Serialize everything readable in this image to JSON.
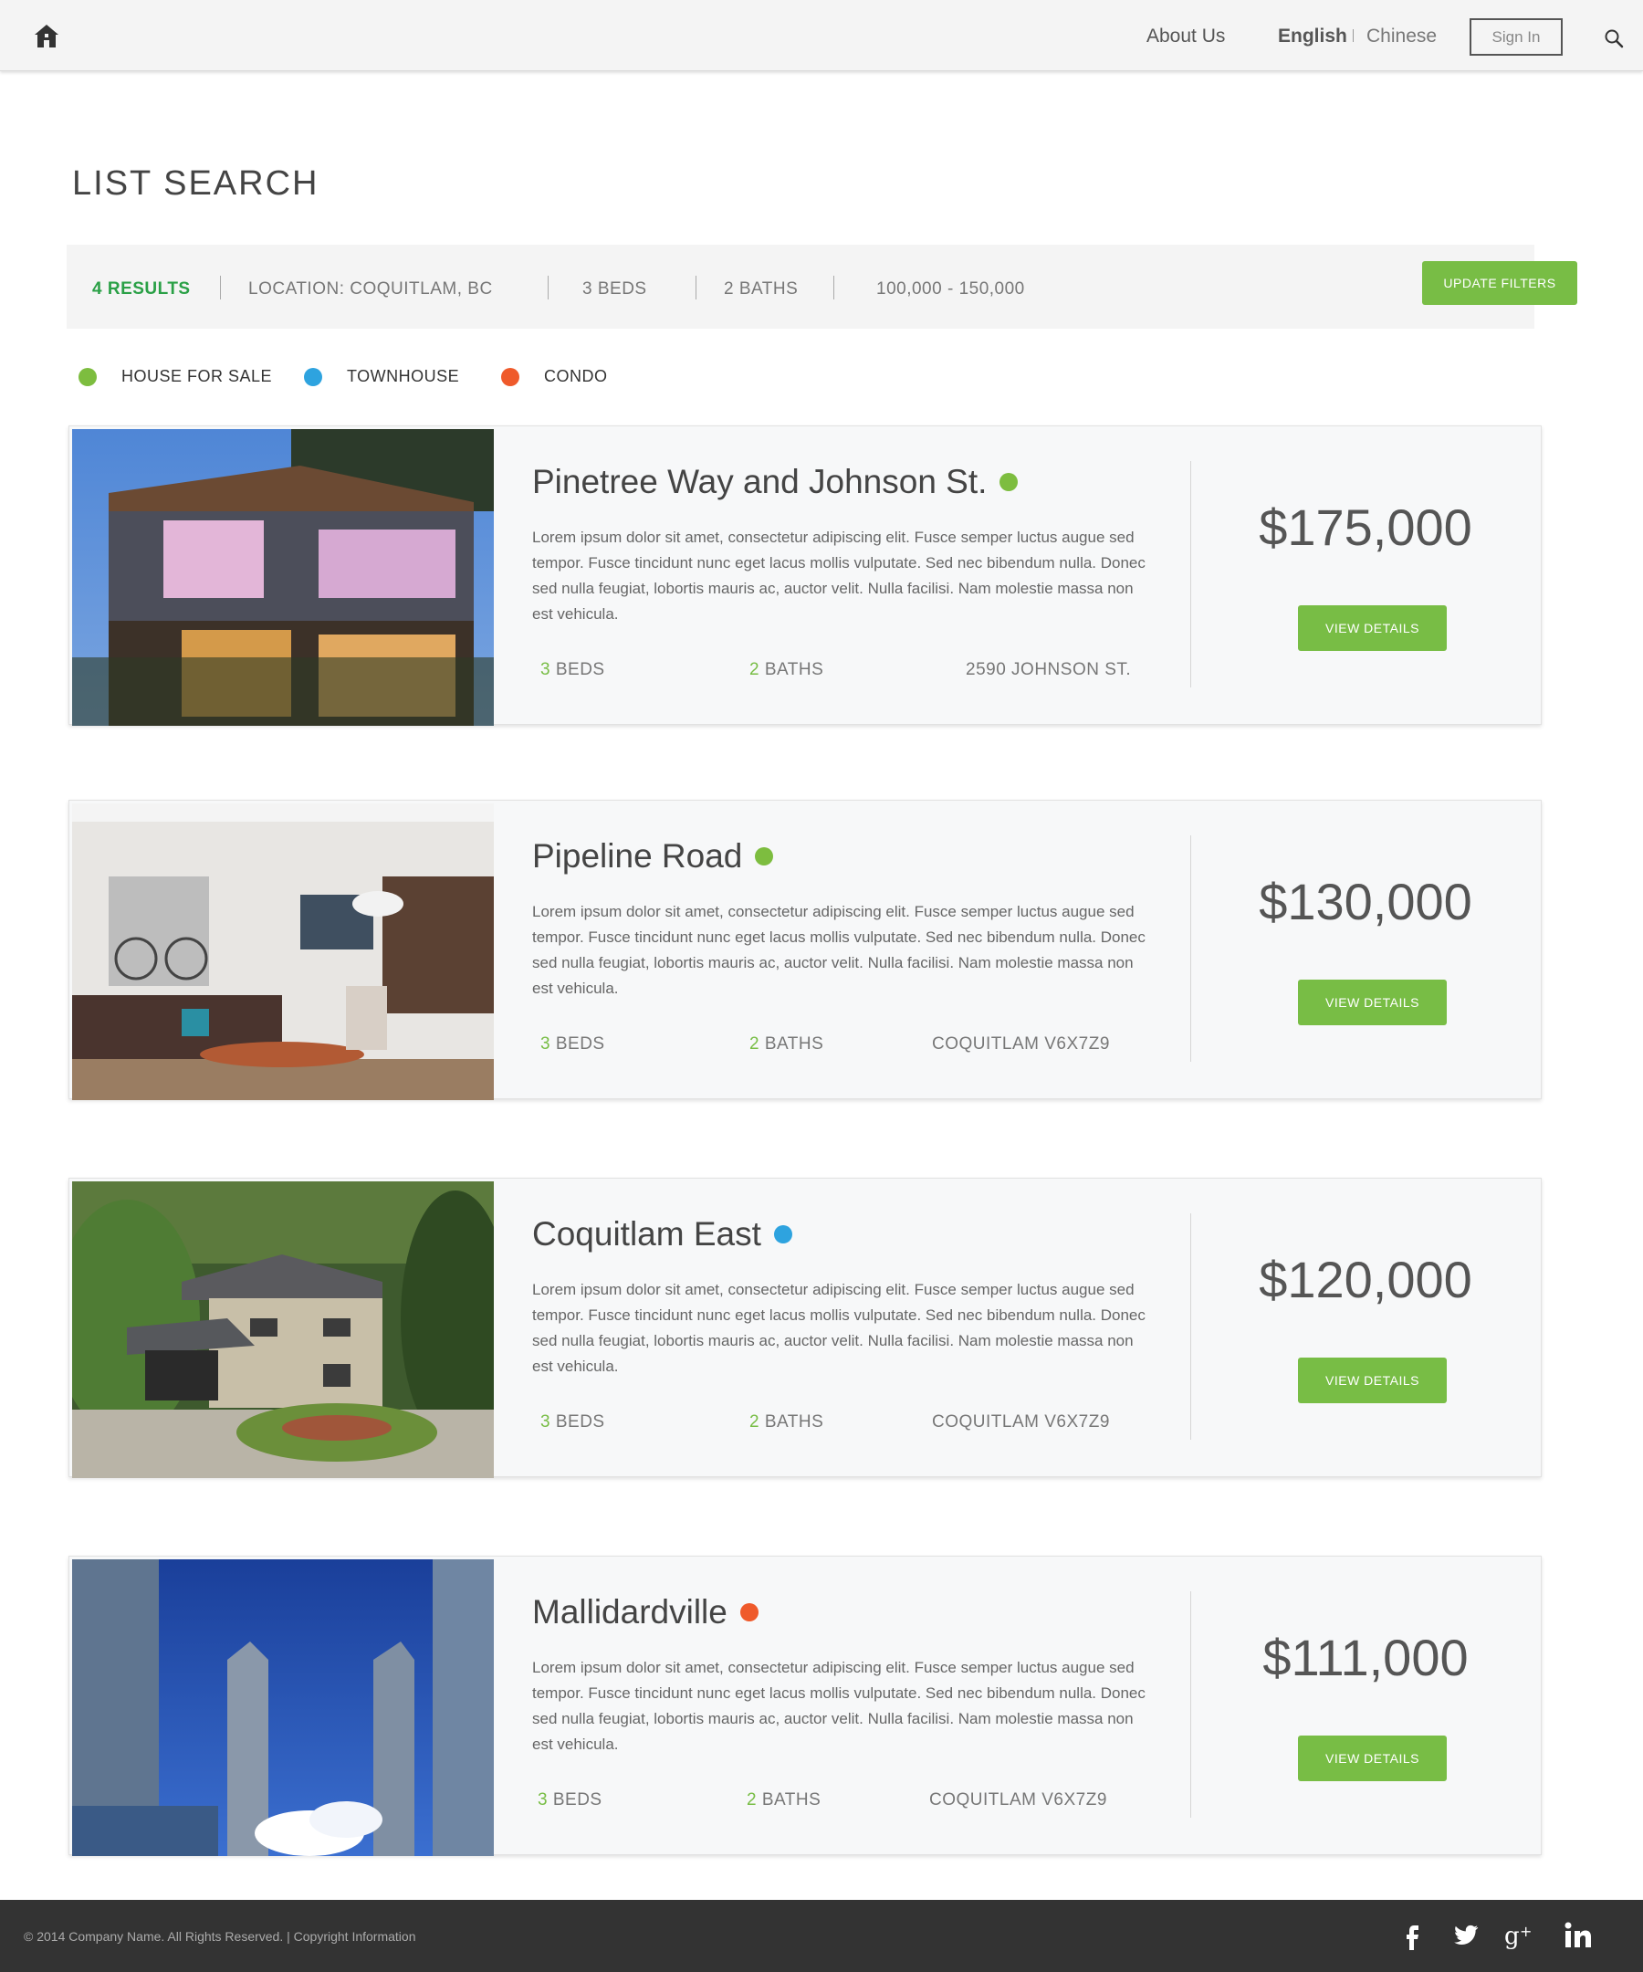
{
  "header": {
    "home_icon": "home-icon",
    "about": "About Us",
    "lang_en": "English",
    "lang_cn": "Chinese",
    "sign_in": "Sign In",
    "search_icon": "search-icon"
  },
  "page_title": "LIST SEARCH",
  "filters": {
    "results": "4 RESULTS",
    "location": "LOCATION: COQUITLAM, BC",
    "beds": "3 BEDS",
    "baths": "2 BATHS",
    "price": "100,000 - 150,000",
    "update_label": "UPDATE FILTERS"
  },
  "legend": [
    {
      "label": "HOUSE FOR SALE",
      "color": "#7dbd3f"
    },
    {
      "label": "TOWNHOUSE",
      "color": "#2ea3df"
    },
    {
      "label": "CONDO",
      "color": "#ef5a2b"
    }
  ],
  "listings": [
    {
      "title": "Pinetree Way and Johnson St.",
      "type_color": "#7dbd3f",
      "description": "Lorem ipsum dolor sit amet, consectetur adipiscing elit. Fusce semper luctus augue sed tempor. Fusce tincidunt nunc eget lacus mollis vulputate. Sed nec bibendum nulla. Donec sed nulla feugiat, lobortis mauris ac, auctor velit. Nulla facilisi. Nam molestie massa non est vehicula.",
      "beds_num": "3",
      "beds_label": " BEDS",
      "baths_num": "2",
      "baths_label": " BATHS",
      "address": "2590 JOHNSON ST.",
      "price": "$175,000",
      "button": "VIEW DETAILS"
    },
    {
      "title": "Pipeline Road",
      "type_color": "#7dbd3f",
      "description": "Lorem ipsum dolor sit amet, consectetur adipiscing elit. Fusce semper luctus augue sed tempor. Fusce tincidunt nunc eget lacus mollis vulputate. Sed nec bibendum nulla. Donec sed nulla feugiat, lobortis mauris ac, auctor velit. Nulla facilisi. Nam molestie massa non est vehicula.",
      "beds_num": "3",
      "beds_label": " BEDS",
      "baths_num": "2",
      "baths_label": " BATHS",
      "address": "COQUITLAM V6X7Z9",
      "price": "$130,000",
      "button": "VIEW DETAILS"
    },
    {
      "title": "Coquitlam East",
      "type_color": "#2ea3df",
      "description": "Lorem ipsum dolor sit amet, consectetur adipiscing elit. Fusce semper luctus augue sed tempor. Fusce tincidunt nunc eget lacus mollis vulputate. Sed nec bibendum nulla. Donec sed nulla feugiat, lobortis mauris ac, auctor velit. Nulla facilisi. Nam molestie massa non est vehicula.",
      "beds_num": "3",
      "beds_label": " BEDS",
      "baths_num": "2",
      "baths_label": " BATHS",
      "address": "COQUITLAM V6X7Z9",
      "price": "$120,000",
      "button": "VIEW DETAILS"
    },
    {
      "title": "Mallidardville",
      "type_color": "#ef5a2b",
      "description": "Lorem ipsum dolor sit amet, consectetur adipiscing elit. Fusce semper luctus augue sed tempor. Fusce tincidunt nunc eget lacus mollis vulputate. Sed nec bibendum nulla. Donec sed nulla feugiat, lobortis mauris ac, auctor velit. Nulla facilisi. Nam molestie massa non est vehicula.",
      "beds_num": "3",
      "beds_label": " BEDS",
      "baths_num": "2",
      "baths_label": " BATHS",
      "address": "COQUITLAM V6X7Z9",
      "price": "$111,000",
      "button": "VIEW DETAILS"
    }
  ],
  "footer": {
    "copyright": "© 2014 Company Name. All Rights Reserved.  | Copyright Information",
    "social": [
      "facebook-icon",
      "twitter-icon",
      "google-plus-icon",
      "linkedin-icon"
    ]
  },
  "colors": {
    "accent_green": "#78bd45",
    "results_green": "#2aa046",
    "footer_bg": "#333333"
  }
}
